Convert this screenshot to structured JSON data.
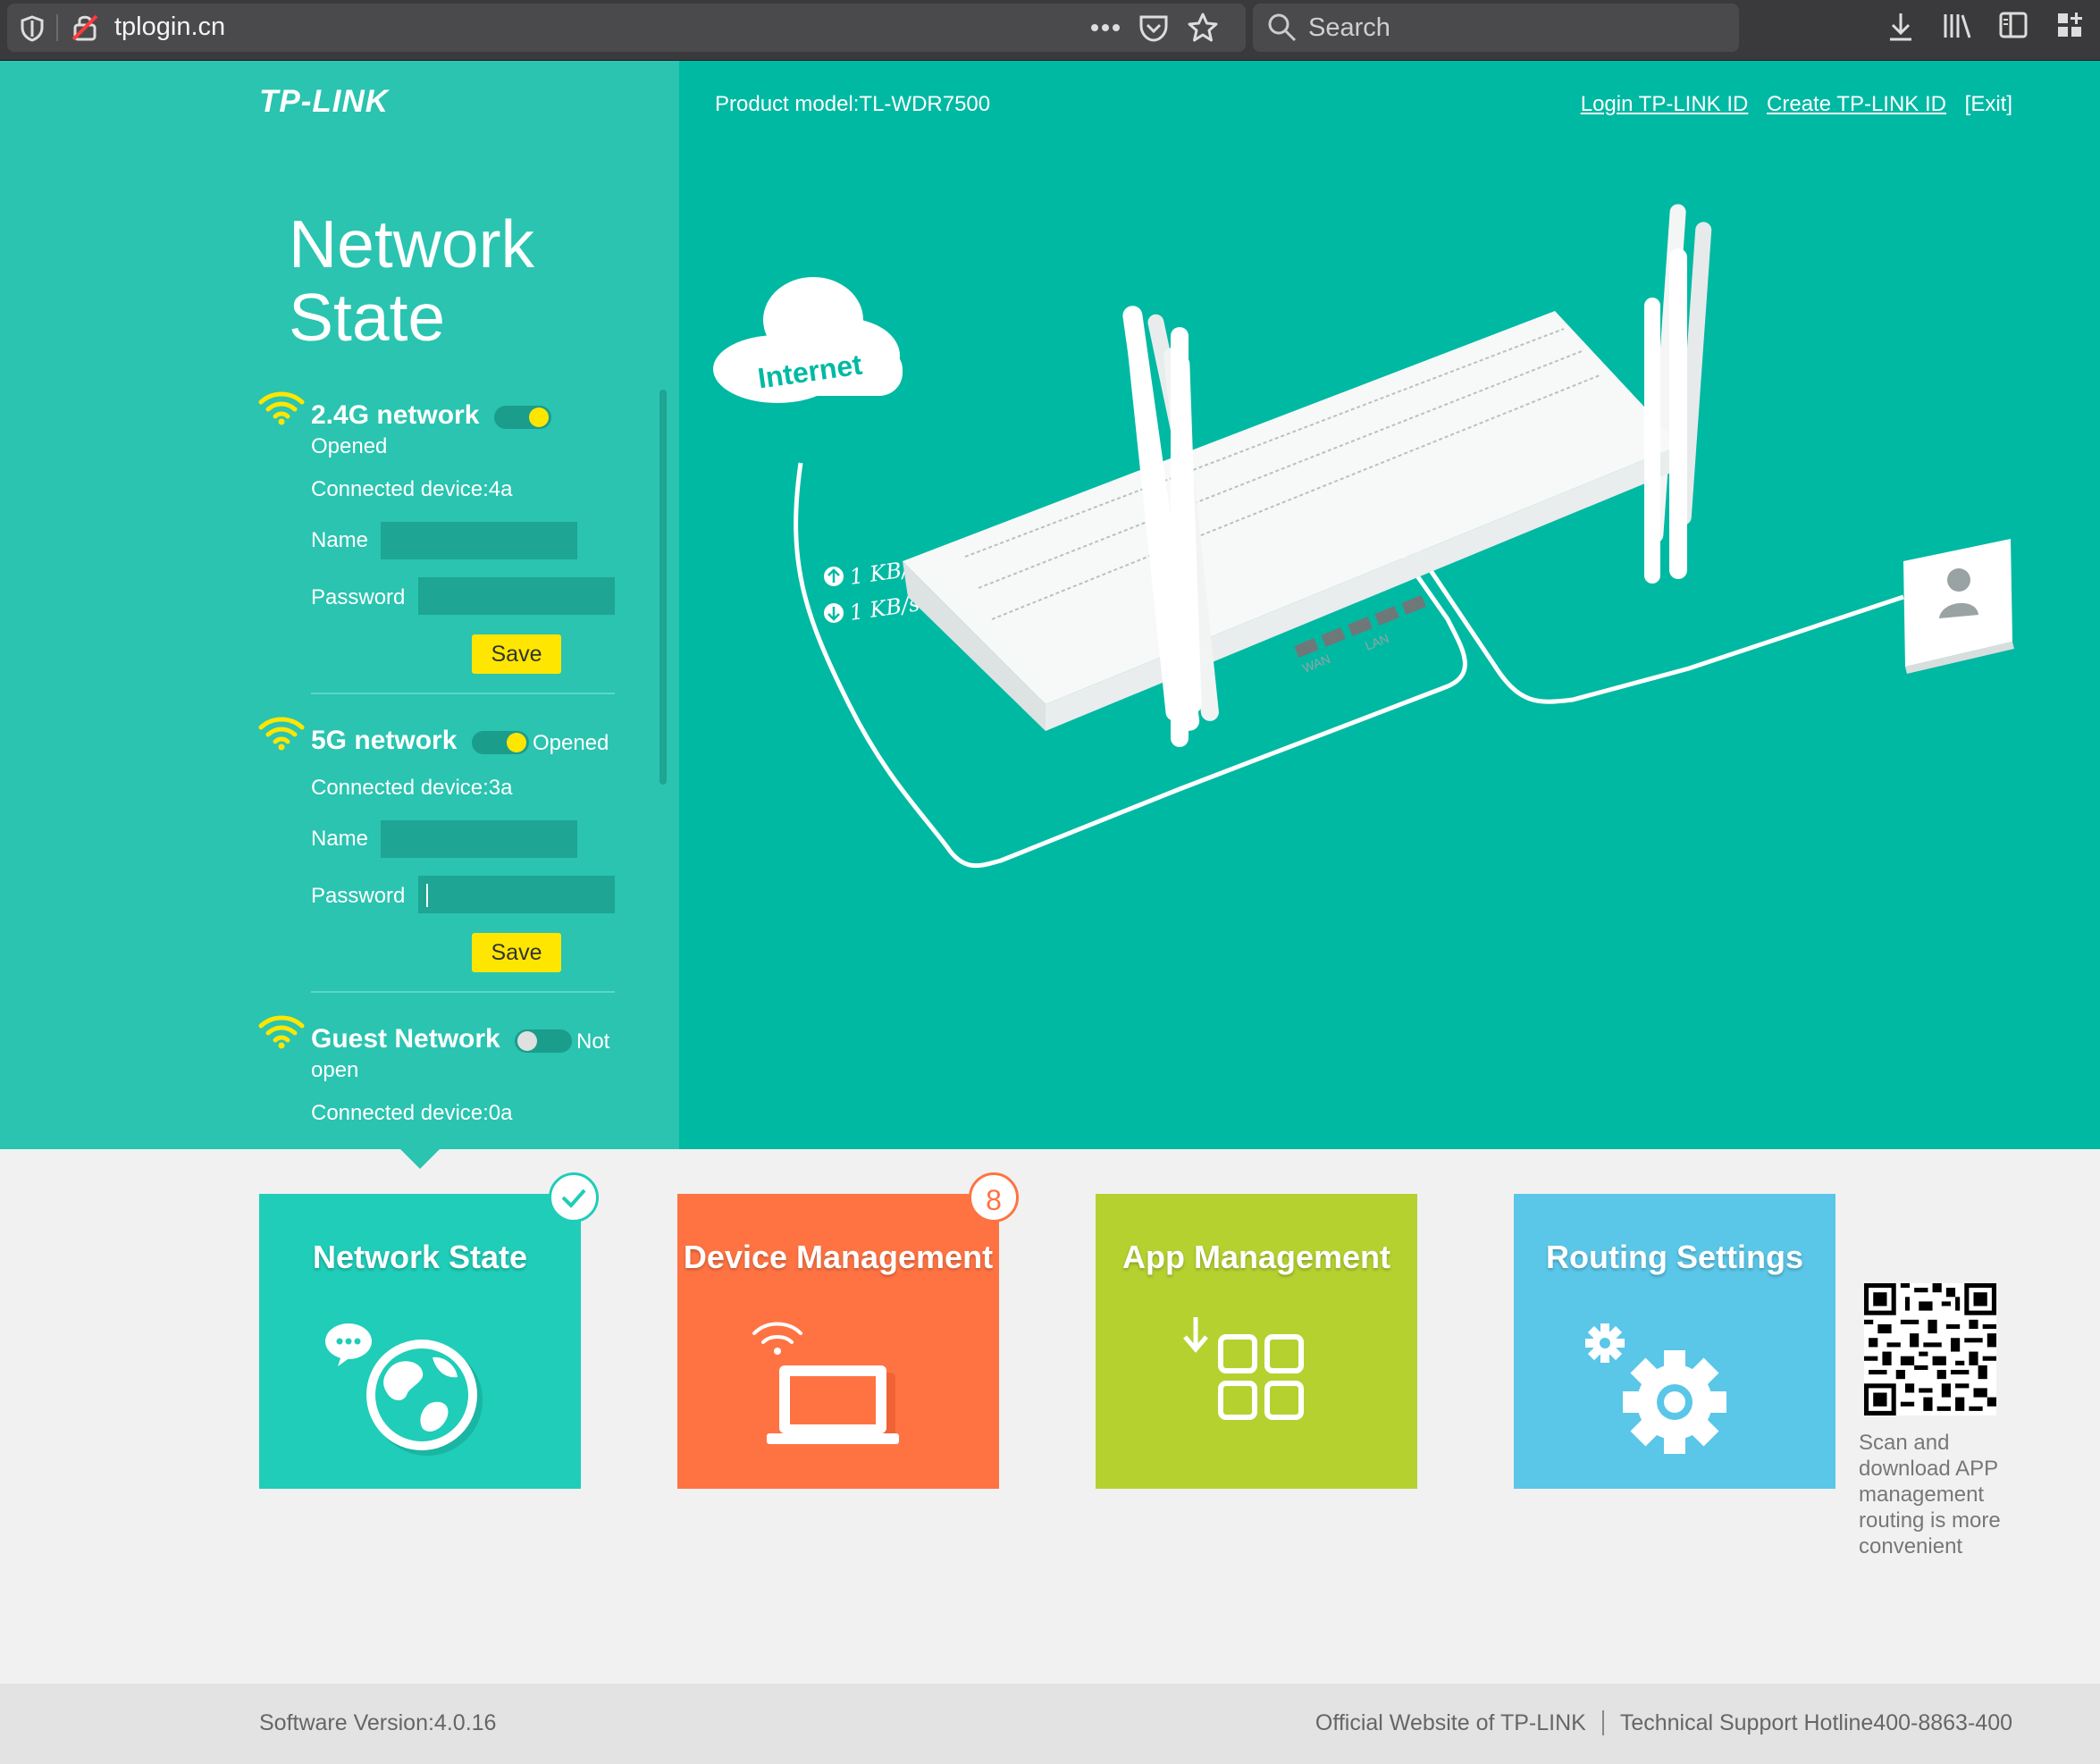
{
  "browser": {
    "url": "tplogin.cn",
    "search_placeholder": "Search"
  },
  "header": {
    "logo": "TP-LINK",
    "model": "Product model:TL-WDR7500",
    "login_link": "Login TP-LINK ID",
    "create_link": "Create TP-LINK ID",
    "exit_link": "[Exit]"
  },
  "sidebar": {
    "title_line1": "Network",
    "title_line2": "State",
    "networks": [
      {
        "title": "2.4G network",
        "state": "Opened",
        "enabled": true,
        "devices": "Connected device:4a",
        "name_label": "Name",
        "name_value": "",
        "password_label": "Password",
        "password_value": "",
        "save_label": "Save"
      },
      {
        "title": "5G network",
        "state": "Opened",
        "enabled": true,
        "devices": "Connected device:3a",
        "name_label": "Name",
        "name_value": "",
        "password_label": "Password",
        "password_value": "",
        "save_label": "Save"
      },
      {
        "title": "Guest Network",
        "state_line1": "Not",
        "state_line2": "open",
        "enabled": false,
        "devices": "Connected device:0a"
      }
    ]
  },
  "diagram": {
    "cloud_label": "Internet",
    "upload_speed": "1 KB/s",
    "download_speed": "1 KB/s",
    "wan_label": "WAN",
    "lan_label": "LAN"
  },
  "tiles": [
    {
      "label": "Network State",
      "color": "#1fcdb8",
      "badge": "check"
    },
    {
      "label": "Device Management",
      "color": "#ff7343",
      "badge": "8"
    },
    {
      "label": "App Management",
      "color": "#b5d130",
      "badge": ""
    },
    {
      "label": "Routing Settings",
      "color": "#5ac6e8",
      "badge": ""
    }
  ],
  "qr_caption": "Scan and download APP management routing is more convenient",
  "footer": {
    "version": "Software Version:4.0.16",
    "official_site": "Official Website of TP-LINK",
    "hotline": "Technical Support Hotline400-8863-400"
  },
  "colors": {
    "teal_bg": "#00b9a3",
    "panel_bg": "#2ac4b0",
    "accent_yellow": "#ffe600"
  }
}
